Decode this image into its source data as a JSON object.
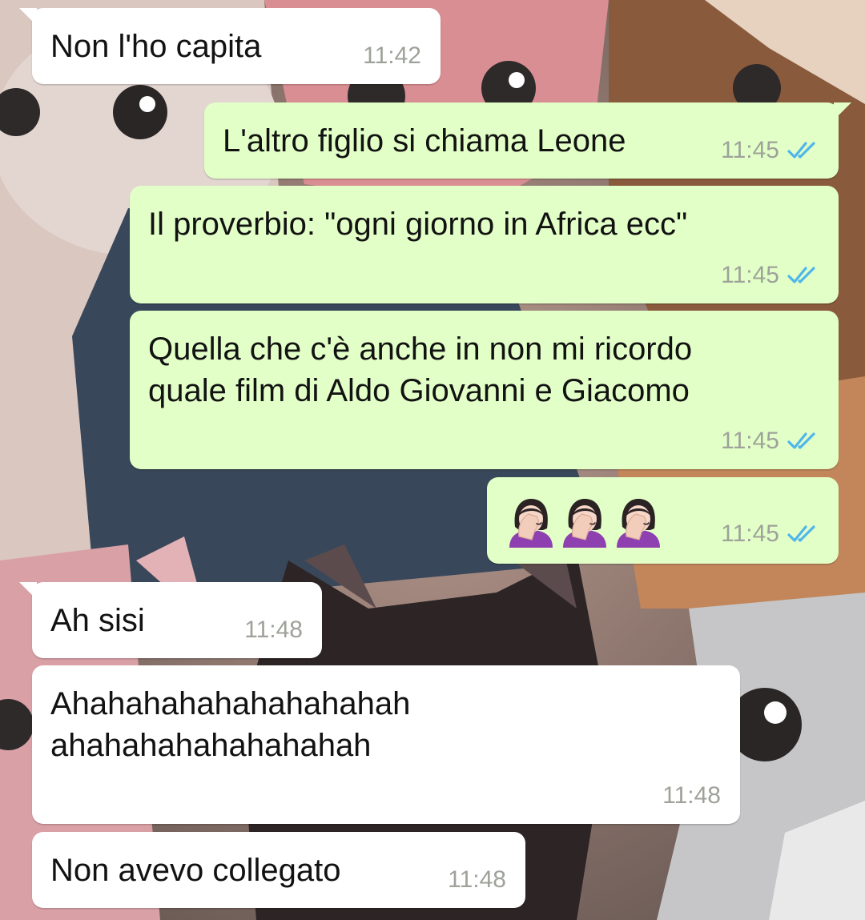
{
  "messages": [
    {
      "direction": "in",
      "text": "Non l'ho capita",
      "time": "11:42"
    },
    {
      "direction": "out",
      "text": "L'altro figlio si chiama Leone",
      "time": "11:45",
      "status": "read-double-tick-icon"
    },
    {
      "direction": "out",
      "text": "Il proverbio: \"ogni giorno in Africa ecc\"",
      "time": "11:45",
      "status": "read-double-tick-icon"
    },
    {
      "direction": "out",
      "text": "Quella che c'è anche in non mi ricordo\nquale film di Aldo Giovanni e Giacomo",
      "time": "11:45",
      "status": "read-double-tick-icon"
    },
    {
      "direction": "out",
      "emoji": [
        "woman-facepalming-emoji",
        "woman-facepalming-emoji",
        "woman-facepalming-emoji"
      ],
      "time": "11:45",
      "status": "read-double-tick-icon"
    },
    {
      "direction": "in",
      "text": "Ah sisi",
      "time": "11:48"
    },
    {
      "direction": "in",
      "text": "Ahahahahahahahahahah\nahahahahahahahahah",
      "time": "11:48"
    },
    {
      "direction": "in",
      "text": "Non avevo collegato",
      "time": "11:48"
    }
  ],
  "colors": {
    "incoming_bubble": "#ffffff",
    "outgoing_bubble": "#e2ffc7",
    "time_text": "#9ea29a",
    "read_tick": "#4fb6ec"
  }
}
